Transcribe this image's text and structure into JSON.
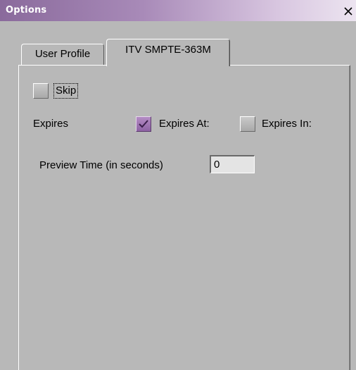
{
  "window": {
    "title": "Options",
    "close_glyph": "X"
  },
  "tabs": [
    {
      "label": "User Profile",
      "selected": false
    },
    {
      "label": "ITV SMPTE-363M",
      "selected": true
    }
  ],
  "skip": {
    "label": "Skip",
    "checked": false
  },
  "expires": {
    "label": "Expires",
    "expires_at": {
      "label": "Expires At:",
      "checked": true
    },
    "expires_in": {
      "label": "Expires In:",
      "checked": false
    }
  },
  "preview": {
    "label": "Preview Time (in seconds)",
    "value": "0"
  },
  "colors": {
    "titlebar_start": "#8a6a9c",
    "titlebar_end": "#ece4f0",
    "panel_bg": "#b8b8b8",
    "checkbox_checked": "#9a6cb0"
  },
  "icons": {
    "close": "close-icon",
    "check": "checkmark-icon"
  }
}
